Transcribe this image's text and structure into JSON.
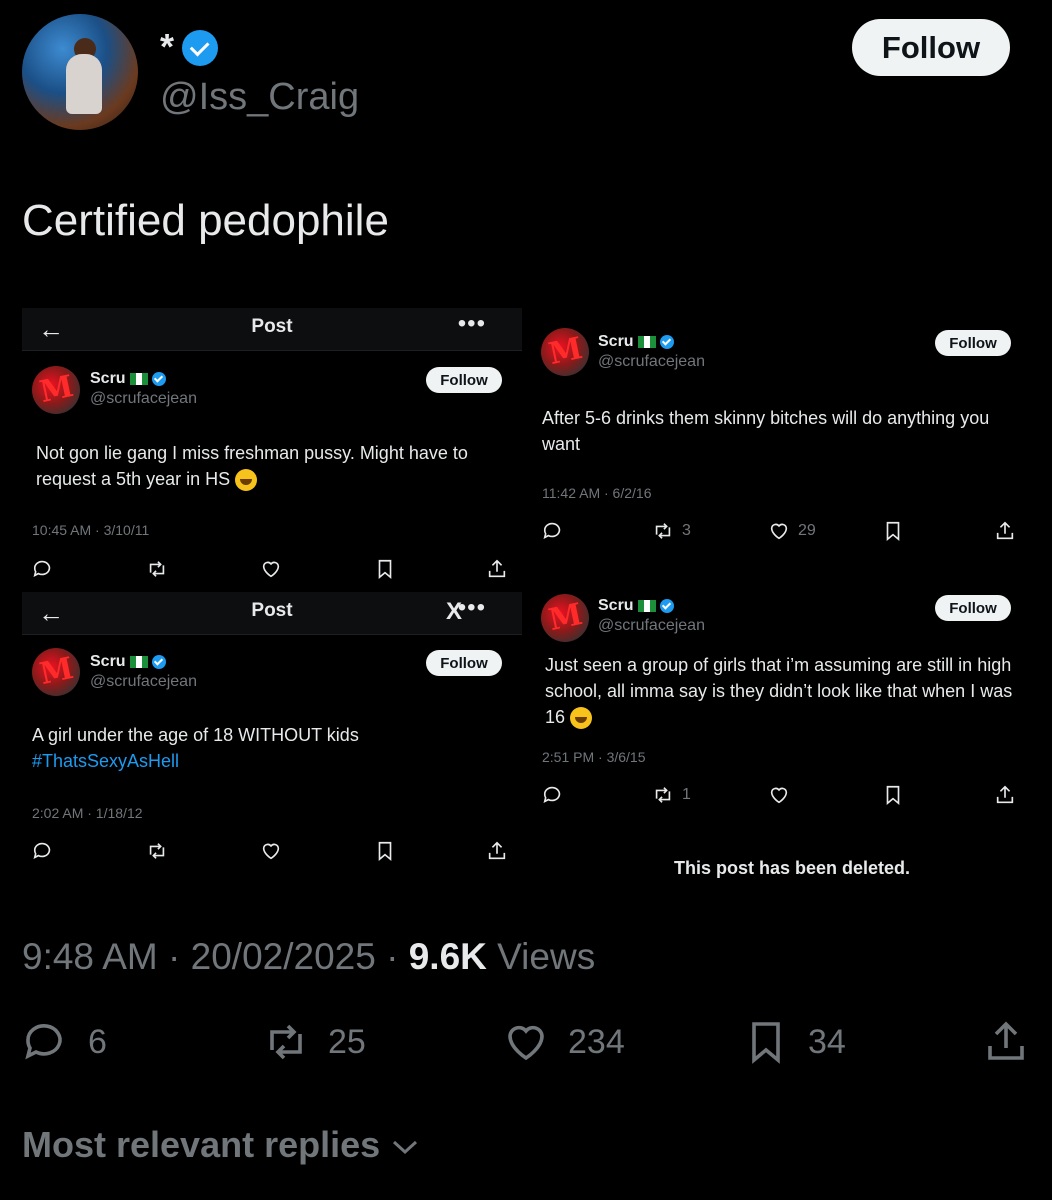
{
  "header": {
    "display_name": "*",
    "handle": "@Iss_Craig",
    "follow_label": "Follow",
    "avatar_icon": "profile-avatar"
  },
  "post": {
    "text": "Certified pedophile",
    "time": "9:48 AM",
    "date": "20/02/2025",
    "views_count": "9.6K",
    "views_label": "Views",
    "replies": "6",
    "reposts": "25",
    "likes": "234",
    "bookmarks": "34"
  },
  "embedded": {
    "topbar_title": "Post",
    "name": "Scru",
    "handle": "@scrufacejean",
    "follow_label": "Follow",
    "tweets": [
      {
        "text": "Not gon lie gang I miss freshman pussy. Might have to request a 5th year in HS",
        "time": "10:45 AM · 3/10/11"
      },
      {
        "text": "After 5-6 drinks them skinny bitches will do anything you want",
        "time": "11:42 AM · 6/2/16",
        "reposts": "3",
        "likes": "29"
      },
      {
        "text": "A girl under the age of 18 WITHOUT kids",
        "hashtag": "#ThatsSexyAsHell",
        "time": "2:02 AM · 1/18/12"
      },
      {
        "text": "Just seen a group of girls that i’m assuming are still in high school, all imma say is they didn’t look like that when I was 16",
        "time": "2:51 PM · 3/6/15",
        "reposts": "1"
      }
    ],
    "deleted_notice": "This post has been deleted."
  },
  "replies_sort_label": "Most relevant replies",
  "colors": {
    "accent": "#1d9bf0",
    "muted": "#71767b",
    "text": "#e7e9ea",
    "background": "#000000"
  }
}
